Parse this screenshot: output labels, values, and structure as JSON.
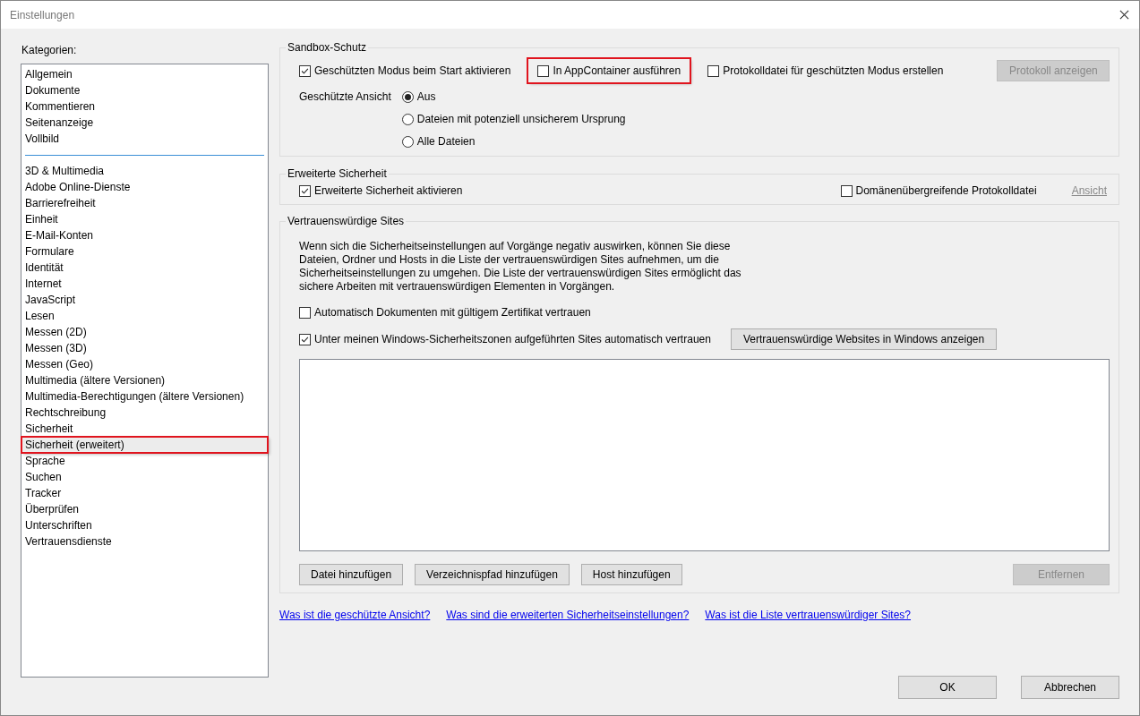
{
  "window": {
    "title": "Einstellungen"
  },
  "sidebar": {
    "label": "Kategorien:",
    "groups": [
      {
        "items": [
          {
            "label": "Allgemein",
            "selected": false,
            "highlighted": false
          },
          {
            "label": "Dokumente",
            "selected": false,
            "highlighted": false
          },
          {
            "label": "Kommentieren",
            "selected": false,
            "highlighted": false
          },
          {
            "label": "Seitenanzeige",
            "selected": false,
            "highlighted": false
          },
          {
            "label": "Vollbild",
            "selected": false,
            "highlighted": false
          }
        ]
      },
      {
        "items": [
          {
            "label": "3D & Multimedia",
            "selected": false,
            "highlighted": false
          },
          {
            "label": "Adobe Online-Dienste",
            "selected": false,
            "highlighted": false
          },
          {
            "label": "Barrierefreiheit",
            "selected": false,
            "highlighted": false
          },
          {
            "label": "Einheit",
            "selected": false,
            "highlighted": false
          },
          {
            "label": "E-Mail-Konten",
            "selected": false,
            "highlighted": false
          },
          {
            "label": "Formulare",
            "selected": false,
            "highlighted": false
          },
          {
            "label": "Identität",
            "selected": false,
            "highlighted": false
          },
          {
            "label": "Internet",
            "selected": false,
            "highlighted": false
          },
          {
            "label": "JavaScript",
            "selected": false,
            "highlighted": false
          },
          {
            "label": "Lesen",
            "selected": false,
            "highlighted": false
          },
          {
            "label": "Messen (2D)",
            "selected": false,
            "highlighted": false
          },
          {
            "label": "Messen (3D)",
            "selected": false,
            "highlighted": false
          },
          {
            "label": "Messen (Geo)",
            "selected": false,
            "highlighted": false
          },
          {
            "label": "Multimedia (ältere Versionen)",
            "selected": false,
            "highlighted": false
          },
          {
            "label": "Multimedia-Berechtigungen (ältere Versionen)",
            "selected": false,
            "highlighted": false
          },
          {
            "label": "Rechtschreibung",
            "selected": false,
            "highlighted": false
          },
          {
            "label": "Sicherheit",
            "selected": false,
            "highlighted": false
          },
          {
            "label": "Sicherheit (erweitert)",
            "selected": true,
            "highlighted": true
          },
          {
            "label": "Sprache",
            "selected": false,
            "highlighted": false
          },
          {
            "label": "Suchen",
            "selected": false,
            "highlighted": false
          },
          {
            "label": "Tracker",
            "selected": false,
            "highlighted": false
          },
          {
            "label": "Überprüfen",
            "selected": false,
            "highlighted": false
          },
          {
            "label": "Unterschriften",
            "selected": false,
            "highlighted": false
          },
          {
            "label": "Vertrauensdienste",
            "selected": false,
            "highlighted": false
          }
        ]
      }
    ]
  },
  "sandbox": {
    "title": "Sandbox-Schutz",
    "checkboxes": [
      {
        "label": "Geschützten Modus beim Start aktivieren",
        "checked": true,
        "highlighted": false
      },
      {
        "label": "In AppContainer ausführen",
        "checked": false,
        "highlighted": true
      },
      {
        "label": "Protokolldatei für geschützten Modus erstellen",
        "checked": false,
        "highlighted": false
      }
    ],
    "button": {
      "label": "Protokoll anzeigen",
      "disabled": true
    },
    "view_label": "Geschützte Ansicht",
    "radios": [
      {
        "label": "Aus",
        "selected": true
      },
      {
        "label": "Dateien mit potenziell unsicherem Ursprung",
        "selected": false
      },
      {
        "label": "Alle Dateien",
        "selected": false
      }
    ]
  },
  "enhanced": {
    "title": "Erweiterte Sicherheit",
    "checkboxes": [
      {
        "label": "Erweiterte Sicherheit aktivieren",
        "checked": true
      },
      {
        "label": "Domänenübergreifende Protokolldatei",
        "checked": false
      }
    ],
    "link": {
      "label": "Ansicht",
      "disabled": true
    }
  },
  "trusted": {
    "title": "Vertrauenswürdige Sites",
    "description": "Wenn sich die Sicherheitseinstellungen auf Vorgänge negativ auswirken,  können Sie diese Dateien, Ordner und Hosts in die Liste der vertrauenswürdigen Sites aufnehmen, um die Sicherheitseinstellungen zu umgehen. Die Liste der vertrauenswürdigen Sites ermöglicht das sichere Arbeiten mit vertrauenswürdigen Elementen in Vorgängen.",
    "checkboxes": [
      {
        "label": "Automatisch Dokumenten mit gültigem Zertifikat vertrauen",
        "checked": false
      },
      {
        "label": "Unter meinen Windows-Sicherheitszonen aufgeführten Sites automatisch vertrauen",
        "checked": true
      }
    ],
    "windows_button": {
      "label": "Vertrauenswürdige Websites in Windows anzeigen",
      "disabled": false
    },
    "list_buttons": [
      {
        "label": "Datei hinzufügen",
        "disabled": false
      },
      {
        "label": "Verzeichnispfad hinzufügen",
        "disabled": false
      },
      {
        "label": "Host hinzufügen",
        "disabled": false
      },
      {
        "label": "Entfernen",
        "disabled": true
      }
    ]
  },
  "help_links": [
    "Was ist die geschützte Ansicht?",
    "Was sind die erweiterten Sicherheitseinstellungen?",
    "Was ist die Liste vertrauenswürdiger Sites?"
  ],
  "buttons": [
    {
      "label": "OK",
      "disabled": false
    },
    {
      "label": "Abbrechen",
      "disabled": false
    }
  ]
}
